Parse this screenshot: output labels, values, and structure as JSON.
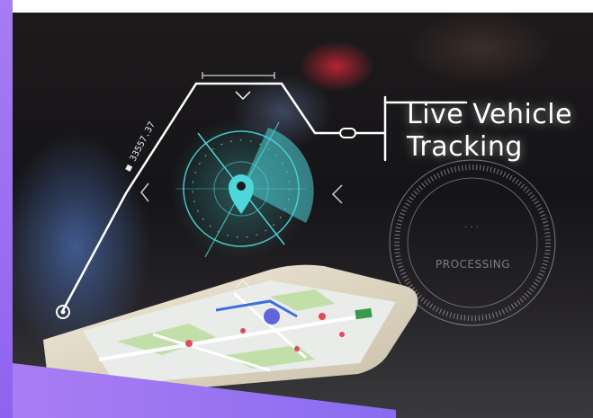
{
  "hud": {
    "title_line1": "Live Vehicle",
    "title_line2": "Tracking",
    "status": "PROCESSING",
    "coordinate": "■ 33557.37"
  },
  "colors": {
    "accent_purple": "#9b6ff2",
    "hud_cyan": "#4fd6d8",
    "hud_white": "#ffffff"
  },
  "icons": [
    "location-pin-icon",
    "chevron-left-icon",
    "chevron-right-icon",
    "chevron-down-icon"
  ]
}
